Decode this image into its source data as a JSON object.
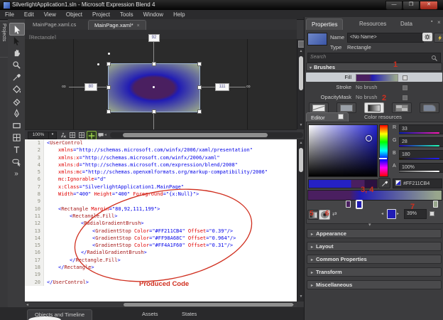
{
  "window": {
    "title": "SilverlightApplication1.sln - Microsoft Expression Blend 4",
    "controls": {
      "minimize": "—",
      "maximize": "❐",
      "close": "✕"
    }
  },
  "menu": {
    "items": [
      "File",
      "Edit",
      "View",
      "Object",
      "Project",
      "Tools",
      "Window",
      "Help"
    ]
  },
  "projects_tab": "Projects",
  "toolbox": {
    "items": [
      {
        "name": "selection-tool",
        "icon": "arrow",
        "selected": true
      },
      {
        "name": "direct-selection-tool",
        "icon": "arrow",
        "selected": false,
        "dark": true
      },
      {
        "name": "pan-tool",
        "icon": "hand",
        "selected": false
      },
      {
        "name": "zoom-tool",
        "icon": "zoom",
        "selected": false
      },
      {
        "name": "eyedropper-tool",
        "icon": "dropper",
        "selected": false
      },
      {
        "name": "paint-bucket-tool",
        "icon": "bucket",
        "selected": false
      },
      {
        "name": "eraser-tool",
        "icon": "eraser",
        "selected": false
      },
      {
        "name": "pen-tool",
        "icon": "pen",
        "selected": false
      },
      {
        "name": "rectangle-tool",
        "icon": "rect",
        "selected": false
      },
      {
        "name": "grid-tool",
        "icon": "grid",
        "selected": false
      },
      {
        "name": "text-tool",
        "icon": "text",
        "selected": false
      },
      {
        "name": "button-tool",
        "icon": "button",
        "selected": false
      },
      {
        "name": "assets-more-tool",
        "icon": "more",
        "selected": false
      }
    ]
  },
  "doc_tabs": {
    "tab1": "MainPage.xaml.cs",
    "tab2": "MainPage.xaml*",
    "tab2_close": "×"
  },
  "breadcrumb": "[Rectangle]",
  "artboard": {
    "zoom_level": "100%",
    "margin_left_badge": "80",
    "margin_right_badge": "111",
    "margin_top_badge": "92",
    "infinity": "∞"
  },
  "code": {
    "lines": [
      {
        "n": 1,
        "ind": 0,
        "seg": [
          [
            "d",
            "<"
          ],
          [
            "e",
            "UserControl"
          ]
        ]
      },
      {
        "n": 2,
        "ind": 1,
        "seg": [
          [
            "a",
            "xmlns"
          ],
          [
            "d",
            "="
          ],
          [
            "v",
            "\"http://schemas.microsoft.com/winfx/2006/xaml/presentation\""
          ]
        ]
      },
      {
        "n": 3,
        "ind": 1,
        "seg": [
          [
            "a",
            "xmlns:x"
          ],
          [
            "d",
            "="
          ],
          [
            "v",
            "\"http://schemas.microsoft.com/winfx/2006/xaml\""
          ]
        ]
      },
      {
        "n": 4,
        "ind": 1,
        "seg": [
          [
            "a",
            "xmlns:d"
          ],
          [
            "d",
            "="
          ],
          [
            "v",
            "\"http://schemas.microsoft.com/expression/blend/2008\""
          ]
        ]
      },
      {
        "n": 5,
        "ind": 1,
        "seg": [
          [
            "a",
            "xmlns:mc"
          ],
          [
            "d",
            "="
          ],
          [
            "v",
            "\"http://schemas.openxmlformats.org/markup-compatibility/2006\""
          ]
        ]
      },
      {
        "n": 6,
        "ind": 1,
        "seg": [
          [
            "a",
            "mc:Ignorable"
          ],
          [
            "d",
            "="
          ],
          [
            "v",
            "\"d\""
          ]
        ]
      },
      {
        "n": 7,
        "ind": 1,
        "seg": [
          [
            "a",
            "x:Class"
          ],
          [
            "d",
            "="
          ],
          [
            "v",
            "\"SilverlightApplication1.MainPage\""
          ]
        ]
      },
      {
        "n": 8,
        "ind": 1,
        "seg": [
          [
            "a",
            "Width"
          ],
          [
            "d",
            "="
          ],
          [
            "v",
            "\"400\""
          ],
          [
            "t",
            " "
          ],
          [
            "a",
            "Height"
          ],
          [
            "d",
            "="
          ],
          [
            "v",
            "\"400\""
          ],
          [
            "t",
            " "
          ],
          [
            "a",
            "Foreground"
          ],
          [
            "d",
            "="
          ],
          [
            "v",
            "\"{x:Null}\""
          ],
          [
            "d",
            ">"
          ]
        ]
      },
      {
        "n": 9,
        "ind": 0,
        "seg": []
      },
      {
        "n": 10,
        "ind": 1,
        "seg": [
          [
            "d",
            "<"
          ],
          [
            "e",
            "Rectangle"
          ],
          [
            "t",
            " "
          ],
          [
            "a",
            "Margin"
          ],
          [
            "d",
            "="
          ],
          [
            "v",
            "\"80,92,111,199\""
          ],
          [
            "d",
            ">"
          ]
        ]
      },
      {
        "n": 11,
        "ind": 2,
        "seg": [
          [
            "d",
            "<"
          ],
          [
            "e",
            "Rectangle.Fill"
          ],
          [
            "d",
            ">"
          ]
        ]
      },
      {
        "n": 12,
        "ind": 3,
        "seg": [
          [
            "d",
            "<"
          ],
          [
            "e",
            "RadialGradientBrush"
          ],
          [
            "d",
            ">"
          ]
        ]
      },
      {
        "n": 13,
        "ind": 4,
        "seg": [
          [
            "d",
            "<"
          ],
          [
            "e",
            "GradientStop"
          ],
          [
            "t",
            " "
          ],
          [
            "a",
            "Color"
          ],
          [
            "d",
            "="
          ],
          [
            "v",
            "\"#FF211CB4\""
          ],
          [
            "t",
            " "
          ],
          [
            "a",
            "Offset"
          ],
          [
            "d",
            "="
          ],
          [
            "v",
            "\"0.39\""
          ],
          [
            "d",
            "/>"
          ]
        ]
      },
      {
        "n": 14,
        "ind": 4,
        "seg": [
          [
            "d",
            "<"
          ],
          [
            "e",
            "GradientStop"
          ],
          [
            "t",
            " "
          ],
          [
            "a",
            "Color"
          ],
          [
            "d",
            "="
          ],
          [
            "v",
            "\"#FF98A68C\""
          ],
          [
            "t",
            " "
          ],
          [
            "a",
            "Offset"
          ],
          [
            "d",
            "="
          ],
          [
            "v",
            "\"0.964\""
          ],
          [
            "d",
            "/>"
          ]
        ]
      },
      {
        "n": 15,
        "ind": 4,
        "seg": [
          [
            "d",
            "<"
          ],
          [
            "e",
            "GradientStop"
          ],
          [
            "t",
            " "
          ],
          [
            "a",
            "Color"
          ],
          [
            "d",
            "="
          ],
          [
            "v",
            "\"#FF4A1F60\""
          ],
          [
            "t",
            " "
          ],
          [
            "a",
            "Offset"
          ],
          [
            "d",
            "="
          ],
          [
            "v",
            "\"0.31\""
          ],
          [
            "d",
            "/>"
          ]
        ]
      },
      {
        "n": 16,
        "ind": 3,
        "seg": [
          [
            "d",
            "</"
          ],
          [
            "e",
            "RadialGradientBrush"
          ],
          [
            "d",
            ">"
          ]
        ]
      },
      {
        "n": 17,
        "ind": 2,
        "seg": [
          [
            "d",
            "</"
          ],
          [
            "e",
            "Rectangle.Fill"
          ],
          [
            "d",
            ">"
          ]
        ]
      },
      {
        "n": 18,
        "ind": 1,
        "seg": [
          [
            "d",
            "</"
          ],
          [
            "e",
            "Rectangle"
          ],
          [
            "d",
            ">"
          ]
        ]
      },
      {
        "n": 19,
        "ind": 0,
        "seg": []
      },
      {
        "n": 20,
        "ind": 0,
        "seg": [
          [
            "d",
            "</"
          ],
          [
            "e",
            "UserControl"
          ],
          [
            "d",
            ">"
          ]
        ]
      }
    ]
  },
  "bottom_tabs": {
    "objects": "Objects and Timeline",
    "assets": "Assets",
    "states": "States"
  },
  "properties": {
    "tabs": {
      "properties": "Properties",
      "resources": "Resources",
      "data": "Data"
    },
    "name_label": "Name",
    "name_value": "<No Name>",
    "type_label": "Type",
    "type_value": "Rectangle",
    "search_placeholder": "Search",
    "brushes": {
      "header": "Brushes",
      "fill_label": "Fill",
      "stroke_label": "Stroke",
      "stroke_value": "No brush",
      "opacity_label": "OpacityMask",
      "opacity_value": "No brush"
    },
    "editor_tab": "Editor",
    "color_resources_tab": "Color resources",
    "rgba": {
      "r_label": "R",
      "r": "33",
      "g_label": "G",
      "g": "28",
      "b_label": "B",
      "b": "180",
      "a_label": "A",
      "a": "100%"
    },
    "hex": "#FF211CB4",
    "gradient": {
      "stops": [
        {
          "color": "#4A1F60",
          "offset": 0.31
        },
        {
          "color": "#211CB4",
          "offset": 0.39,
          "selected": true
        },
        {
          "color": "#98A68C",
          "offset": 0.964
        }
      ],
      "selected_offset_pct": "39%"
    },
    "sections": [
      "Appearance",
      "Layout",
      "Common Properties",
      "Transform",
      "Miscellaneous"
    ]
  },
  "annotations": {
    "n1": "1",
    "n2": "2",
    "n34": "3, 4",
    "n5": "5",
    "n6": "6",
    "n7": "7",
    "produced_code": "Produced Code",
    "color": "#d02f1f"
  },
  "glyphs": {
    "close": "×",
    "pin": "▪",
    "tri_down": "▾",
    "tri_right": "▸",
    "arrow_left": "◂",
    "arrow_right": "▸",
    "arrow_up": "▲",
    "arrow_dn": "▼",
    "reverse": "⇄",
    "more": "»",
    "chevron": "▾",
    "search": "⌕"
  }
}
